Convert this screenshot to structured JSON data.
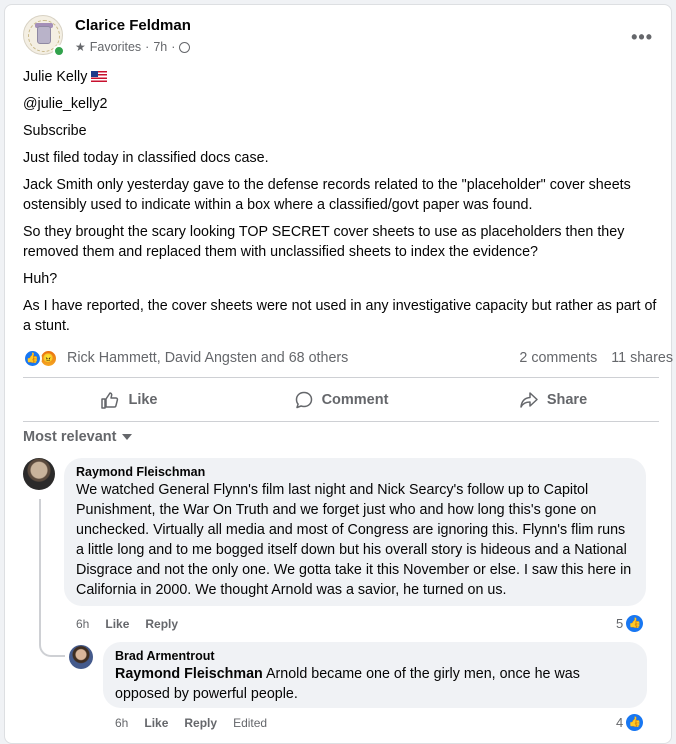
{
  "post": {
    "author": "Clarice Feldman",
    "audience": "Favorites",
    "time": "7h",
    "more_icon": "more-horizontal-icon",
    "paragraphs": [
      "Julie Kelly",
      "@julie_kelly2",
      "Subscribe",
      "Just filed today in classified docs case.",
      "Jack Smith only yesterday gave to the defense records related to the \"placeholder\" cover sheets ostensibly used to indicate within a box where a classified/govt paper was found.",
      "So they brought the scary looking TOP SECRET cover sheets to use as placeholders then they removed them and replaced them with unclassified sheets to index the evidence?",
      "Huh?",
      "As I have reported, the cover sheets were not used in any investigative capacity but rather as part of a stunt."
    ]
  },
  "reactions": {
    "names": "Rick Hammett, David Angsten and 68 others",
    "comments": "2 comments",
    "shares": "11 shares"
  },
  "actions": {
    "like": "Like",
    "comment": "Comment",
    "share": "Share"
  },
  "sort": {
    "label": "Most relevant"
  },
  "comments": [
    {
      "author": "Raymond Fleischman",
      "text": "We watched General Flynn's film last night and Nick Searcy's follow up to Capitol Punishment, the War On Truth and we forget just who and how long this's gone on unchecked. Virtually all media and most of Congress are ignoring this. Flynn's flim runs a little long and to me bogged itself down but his overall story is hideous and a National Disgrace and not the only one. We gotta take it this November or else. I saw this here in California in 2000. We thought Arnold was a savior, he turned on us.",
      "time": "6h",
      "like": "Like",
      "reply": "Reply",
      "reaction_count": "5"
    },
    {
      "author": "Brad Armentrout",
      "mention": "Raymond Fleischman",
      "text": " Arnold became one of the girly men, once he was opposed by powerful people.",
      "time": "6h",
      "like": "Like",
      "reply": "Reply",
      "edited": "Edited",
      "reaction_count": "4"
    }
  ]
}
